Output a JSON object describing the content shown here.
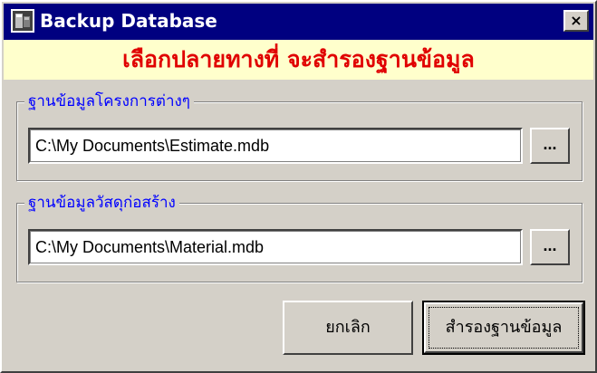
{
  "window": {
    "title": "Backup Database",
    "close_label": "×",
    "colors": {
      "titlebar": "#000080",
      "banner_bg": "#ffffcc",
      "banner_text": "#e00000",
      "group_label": "#0000ff",
      "face": "#d4d0c8"
    }
  },
  "banner": {
    "text": "เลือกปลายทางที่ จะสำรองฐานข้อมูล"
  },
  "groups": [
    {
      "label": "ฐานข้อมูลโครงการต่างๆ",
      "path": "C:\\My Documents\\Estimate.mdb",
      "browse_label": "..."
    },
    {
      "label": "ฐานข้อมูลวัสดุก่อสร้าง",
      "path": "C:\\My Documents\\Material.mdb",
      "browse_label": "..."
    }
  ],
  "buttons": {
    "cancel": "ยกเลิก",
    "backup": "สำรองฐานข้อมูล"
  },
  "icons": {
    "app": "app-database-icon",
    "close": "close-icon"
  }
}
